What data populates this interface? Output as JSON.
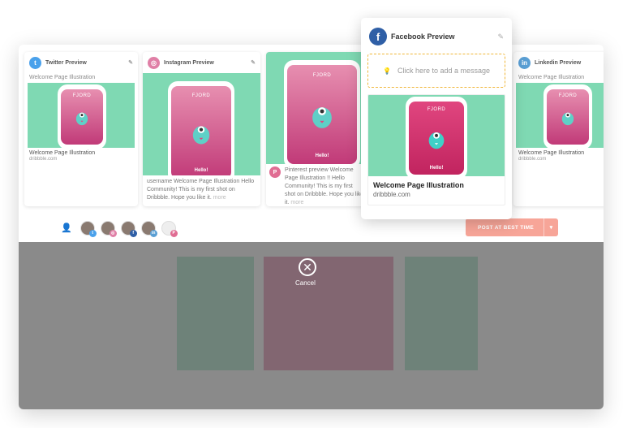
{
  "cards": {
    "twitter": {
      "title": "Twitter Preview",
      "subtitle": "Welcome Page Illustration",
      "link_title": "Welcome Page Illustration",
      "link_source": "dribbble.com",
      "icon": "twitter-icon",
      "color": "#4aa1eb"
    },
    "instagram": {
      "title": "Instagram Preview",
      "caption": "username Welcome Page Illustration Hello Community! This is my first shot on Dribbble. Hope you like it.",
      "more": "more",
      "icon": "instagram-icon",
      "color": "#e07fa6"
    },
    "pinterest": {
      "title": "Pinterest preview",
      "caption": "Welcome Page Illustration !! Hello Community! This is my first shot on Dribbble. Hope you like it.",
      "more": "more",
      "icon": "pinterest-icon",
      "color": "#e06d93"
    },
    "linkedin": {
      "title": "Linkedin Preview",
      "subtitle": "Welcome Page Illustration",
      "link_title": "Welcome Page Illustration",
      "link_source": "dribbble.com",
      "icon": "linkedin-icon",
      "color": "#5a9fd4"
    }
  },
  "facebook": {
    "title": "Facebook Preview",
    "message_placeholder": "Click here to add a message",
    "link_title": "Welcome Page Illustration",
    "link_source": "dribbble.com",
    "icon": "facebook-icon",
    "color": "#2f5fa6"
  },
  "phone": {
    "brand": "FJORD",
    "greeting": "Hello!"
  },
  "actions": {
    "post_label": "POST AT BEST TIME",
    "caret": "▾"
  },
  "cancel": {
    "label": "Cancel",
    "icon": "close-icon"
  },
  "colors": {
    "mint": "#7fd9b3",
    "pink": "#d95b8e",
    "accent": "#f7a598"
  }
}
